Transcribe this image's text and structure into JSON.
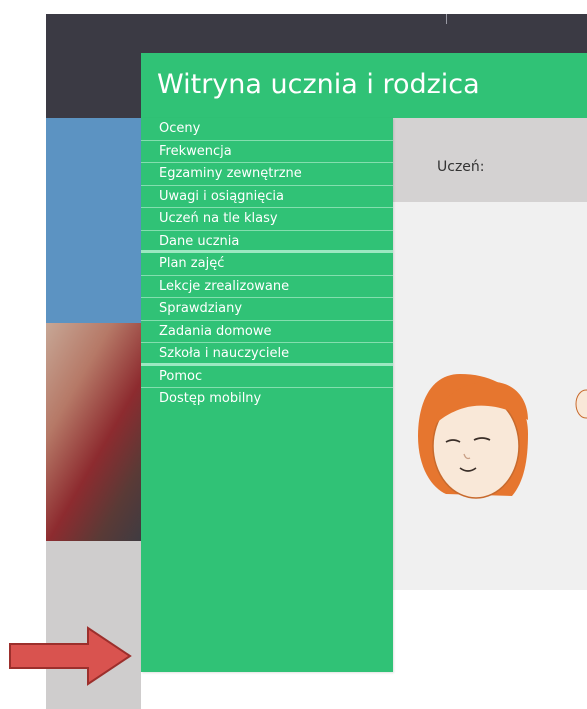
{
  "menu": {
    "title": "Witryna ucznia i rodzica",
    "items": [
      {
        "label": "Oceny"
      },
      {
        "label": "Frekwencja"
      },
      {
        "label": "Egzaminy zewnętrzne"
      },
      {
        "label": "Uwagi i osiągnięcia"
      },
      {
        "label": "Uczeń na tle klasy"
      },
      {
        "label": "Dane ucznia"
      },
      {
        "label": "Plan zajęć"
      },
      {
        "label": "Lekcje zrealizowane"
      },
      {
        "label": "Sprawdziany"
      },
      {
        "label": "Zadania domowe"
      },
      {
        "label": "Szkoła i nauczyciele"
      },
      {
        "label": "Pomoc"
      },
      {
        "label": "Dostęp mobilny"
      }
    ]
  },
  "content": {
    "student_label": "Uczeń:"
  },
  "colors": {
    "menu_green": "#30c276",
    "top_bar": "#3b3a44",
    "arrow_red": "#d9534f"
  }
}
